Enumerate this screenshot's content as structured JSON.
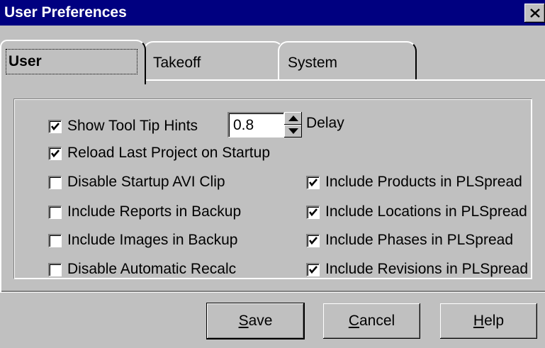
{
  "window": {
    "title": "User Preferences",
    "close_glyph": "close-icon"
  },
  "tabs": [
    {
      "label": "User",
      "active": true
    },
    {
      "label": "Takeoff",
      "active": false
    },
    {
      "label": "System",
      "active": false
    }
  ],
  "user_tab": {
    "tooltip": {
      "label": "Show Tool Tip Hints",
      "checked": true,
      "delay_value": "0.8",
      "delay_label": "Delay"
    },
    "left_options": [
      {
        "label": "Reload Last Project on Startup",
        "checked": true
      },
      {
        "label": "Disable Startup AVI Clip",
        "checked": false
      },
      {
        "label": "Include Reports in Backup",
        "checked": false
      },
      {
        "label": "Include Images in Backup",
        "checked": false
      },
      {
        "label": "Disable Automatic Recalc",
        "checked": false
      }
    ],
    "right_options": [
      {
        "label": "Include Products in PLSpread",
        "checked": true
      },
      {
        "label": "Include Locations in PLSpread",
        "checked": true
      },
      {
        "label": "Include Phases in PLSpread",
        "checked": true
      },
      {
        "label": "Include Revisions in PLSpread",
        "checked": true
      }
    ]
  },
  "buttons": {
    "save": {
      "mnemonic": "S",
      "rest": "ave"
    },
    "cancel": {
      "mnemonic": "C",
      "rest": "ancel"
    },
    "help": {
      "mnemonic": "H",
      "rest": "elp"
    }
  }
}
